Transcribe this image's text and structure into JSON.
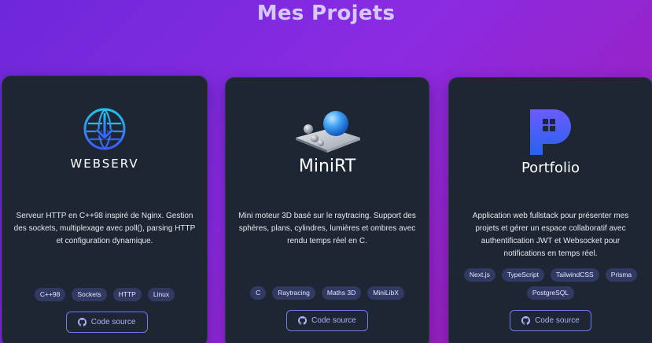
{
  "page": {
    "title": "Mes Projets"
  },
  "colors": {
    "background_start": "#6d28d9",
    "background_end": "#a21caf",
    "card": "#1f2633",
    "tag": "#313a63",
    "button_border": "#6d7cf0",
    "button_text": "#a9b3ff"
  },
  "projects": [
    {
      "logo_text": "WEBSERV",
      "logo_icon": "globe-download-icon",
      "description": "Serveur HTTP en C++98 inspiré de Nginx. Gestion des sockets, multiplexage avec poll(), parsing HTTP et configuration dynamique.",
      "tags": [
        "C++98",
        "Sockets",
        "HTTP",
        "Linux"
      ],
      "source_label": "Code source"
    },
    {
      "logo_text": "MiniRT",
      "logo_icon": "spheres-on-plane-icon",
      "description": "Mini moteur 3D basé sur le raytracing. Support des sphères, plans, cylindres, lumières et ombres avec rendu temps réel en C.",
      "tags": [
        "C",
        "Raytracing",
        "Maths 3D",
        "MiniLibX"
      ],
      "source_label": "Code source"
    },
    {
      "logo_text": "Portfolio",
      "logo_icon": "portfolio-p-icon",
      "description": "Application web fullstack pour présenter mes projets et gérer un espace collaboratif avec authentification JWT et Websocket pour notifications en temps réel.",
      "tags": [
        "Next.js",
        "TypeScript",
        "TailwindCSS",
        "Prisma",
        "PostgreSQL"
      ],
      "source_label": "Code source"
    }
  ]
}
